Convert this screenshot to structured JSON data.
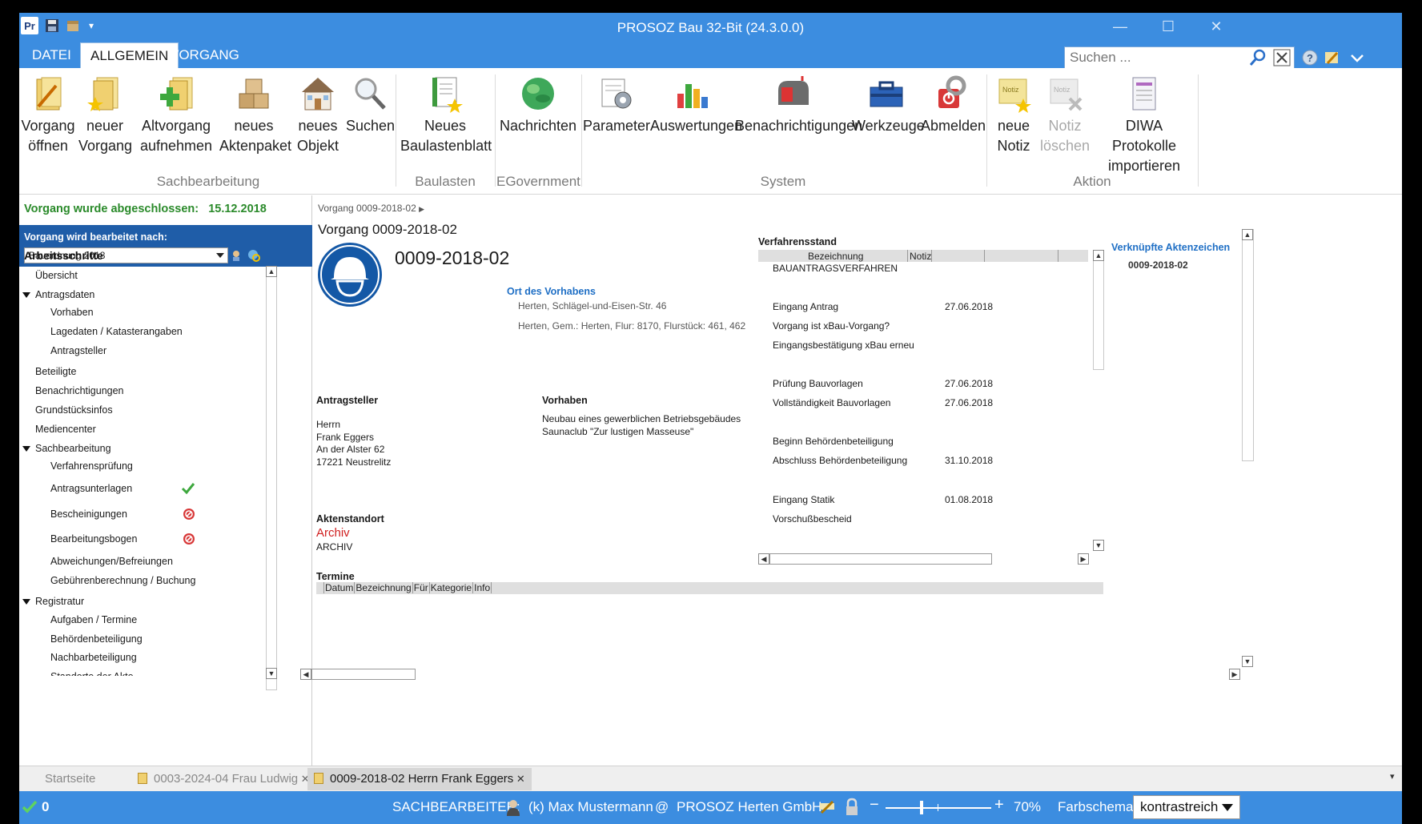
{
  "window": {
    "app_title": "PROSOZ Bau 32-Bit (24.3.0.0)",
    "minimize": "—",
    "maximize": "☐",
    "close": "✕"
  },
  "ribbon_tabs": [
    "DATEI",
    "ALLGEMEIN",
    "VORGANG"
  ],
  "search": {
    "placeholder": "Suchen ..."
  },
  "ribbon": {
    "buttons": [
      {
        "line1": "Vorgang",
        "line2": "öffnen",
        "icon": "folder-edit-icon"
      },
      {
        "line1": "neuer",
        "line2": "Vorgang",
        "icon": "folder-new-icon"
      },
      {
        "line1": "Altvorgang",
        "line2": "aufnehmen",
        "icon": "folder-add-icon"
      },
      {
        "line1": "neues",
        "line2": "Aktenpaket",
        "icon": "boxes-icon"
      },
      {
        "line1": "neues",
        "line2": "Objekt",
        "icon": "house-icon"
      },
      {
        "line1": "Suchen",
        "line2": "",
        "icon": "magnifier-icon"
      },
      {
        "line1": "Neues",
        "line2": "Baulastenblatt",
        "icon": "document-star-icon"
      },
      {
        "line1": "Nachrichten",
        "line2": "",
        "icon": "globe-icon"
      },
      {
        "line1": "Parameter",
        "line2": "",
        "icon": "parameter-gear-icon"
      },
      {
        "line1": "Auswertungen",
        "line2": "",
        "icon": "bar-chart-icon"
      },
      {
        "line1": "Benachrichtigungen",
        "line2": "",
        "icon": "mailbox-icon"
      },
      {
        "line1": "Werkzeuge",
        "line2": "",
        "icon": "toolbox-icon"
      },
      {
        "line1": "Abmelden",
        "line2": "",
        "icon": "logout-icon"
      },
      {
        "line1": "neue",
        "line2": "Notiz",
        "icon": "note-new-icon"
      },
      {
        "line1": "Notiz",
        "line2": "löschen",
        "icon": "note-delete-icon"
      },
      {
        "line1": "DIWA Protokolle",
        "line2": "importieren",
        "icon": "protocol-import-icon"
      }
    ],
    "groups": [
      "Sachbearbeitung",
      "Baulasten",
      "EGovernment",
      "System",
      "Aktion"
    ]
  },
  "left": {
    "closed_label": "Vorgang wurde abgeschlossen:",
    "closed_date": "15.12.2018",
    "edited_by_label": "Vorgang wird bearbeitet nach:",
    "edited_by_value": "Bauordnung 2018",
    "section": "Arbeitsschritte",
    "tree": [
      {
        "label": "Übersicht",
        "level": 1
      },
      {
        "label": "Antragsdaten",
        "level": 1,
        "group": true
      },
      {
        "label": "Vorhaben",
        "level": 2
      },
      {
        "label": "Lagedaten / Katasterangaben",
        "level": 2
      },
      {
        "label": "Antragsteller",
        "level": 2
      },
      {
        "label": "Beteiligte",
        "level": 1
      },
      {
        "label": "Benachrichtigungen",
        "level": 1
      },
      {
        "label": "Grundstücksinfos",
        "level": 1
      },
      {
        "label": "Mediencenter",
        "level": 1
      },
      {
        "label": "Sachbearbeitung",
        "level": 1,
        "group": true
      },
      {
        "label": "Verfahrensprüfung",
        "level": 2
      },
      {
        "label": "Antragsunterlagen",
        "level": 2,
        "status": "ok"
      },
      {
        "label": "Bescheinigungen",
        "level": 2,
        "status": "blocked"
      },
      {
        "label": "Bearbeitungsbogen",
        "level": 2,
        "status": "blocked"
      },
      {
        "label": "Abweichungen/Befreiungen",
        "level": 2
      },
      {
        "label": "Gebührenberechnung / Buchung",
        "level": 2
      },
      {
        "label": "Registratur",
        "level": 1,
        "group": true
      },
      {
        "label": "Aufgaben / Termine",
        "level": 2
      },
      {
        "label": "Behördenbeteiligung",
        "level": 2
      },
      {
        "label": "Nachbarbeteiligung",
        "level": 2
      },
      {
        "label": "Standorte der Akte",
        "level": 2
      }
    ]
  },
  "main": {
    "breadcrumb": "Vorgang 0009-2018-02",
    "heading": "Vorgang 0009-2018-02",
    "case_number": "0009-2018-02",
    "ort_label": "Ort des Vorhabens",
    "ort_address": "Herten, Schlägel-und-Eisen-Str. 46",
    "ort_cadastre": "Herten, Gem.: Herten, Flur: 8170, Flurstück: 461, 462",
    "antragsteller_label": "Antragsteller",
    "antragsteller_lines": [
      "Herrn",
      "Frank Eggers",
      "An der Alster 62",
      "17221 Neustrelitz"
    ],
    "vorhaben_label": "Vorhaben",
    "vorhaben_lines": [
      "Neubau eines gewerblichen Betriebsgebäudes",
      "Saunaclub \"Zur lustigen Masseuse\""
    ],
    "aktenstandort_label": "Aktenstandort",
    "aktenstandort_value": "Archiv",
    "aktenstandort_code": "ARCHIV",
    "verfahrensstand_label": "Verfahrensstand",
    "verf_columns": [
      "Bezeichnung",
      "Notiz"
    ],
    "verf_first_row": "BAUANTRAGSVERFAHREN",
    "verf_rows": [
      {
        "label": "Eingang Antrag",
        "date": "27.06.2018"
      },
      {
        "label": "Vorgang ist xBau-Vorgang?",
        "date": ""
      },
      {
        "label": "Eingangsbestätigung xBau erneut ve",
        "date": ""
      },
      {
        "label": "Prüfung  Bauvorlagen",
        "date": "27.06.2018"
      },
      {
        "label": "Vollständigkeit Bauvorlagen",
        "date": "27.06.2018"
      },
      {
        "label": "Beginn Behördenbeteiligung",
        "date": ""
      },
      {
        "label": "Abschluss Behördenbeteiligung",
        "date": "31.10.2018"
      },
      {
        "label": "Eingang Statik",
        "date": "01.08.2018"
      },
      {
        "label": "Vorschußbescheid",
        "date": ""
      }
    ],
    "linked_label": "Verknüpfte Aktenzeichen",
    "linked_value": "0009-2018-02",
    "termine_label": "Termine",
    "termine_columns": [
      "Datum",
      "Bezeichnung",
      "Für",
      "Kategorie",
      "Info"
    ]
  },
  "doc_tabs": [
    {
      "label": "Startseite"
    },
    {
      "label": "0003-2024-04 Frau  Ludwig"
    },
    {
      "label": "0009-2018-02 Herrn Frank Eggers"
    }
  ],
  "status": {
    "count": "0",
    "clerk_label": "SACHBEARBEITER:",
    "clerk": "(k) Max Mustermann",
    "at": "@",
    "org": "PROSOZ Herten GmbH",
    "zoom": "70%",
    "zoom_level": 0.7,
    "scheme_label": "Farbschema",
    "scheme_value": "kontrastreich"
  }
}
